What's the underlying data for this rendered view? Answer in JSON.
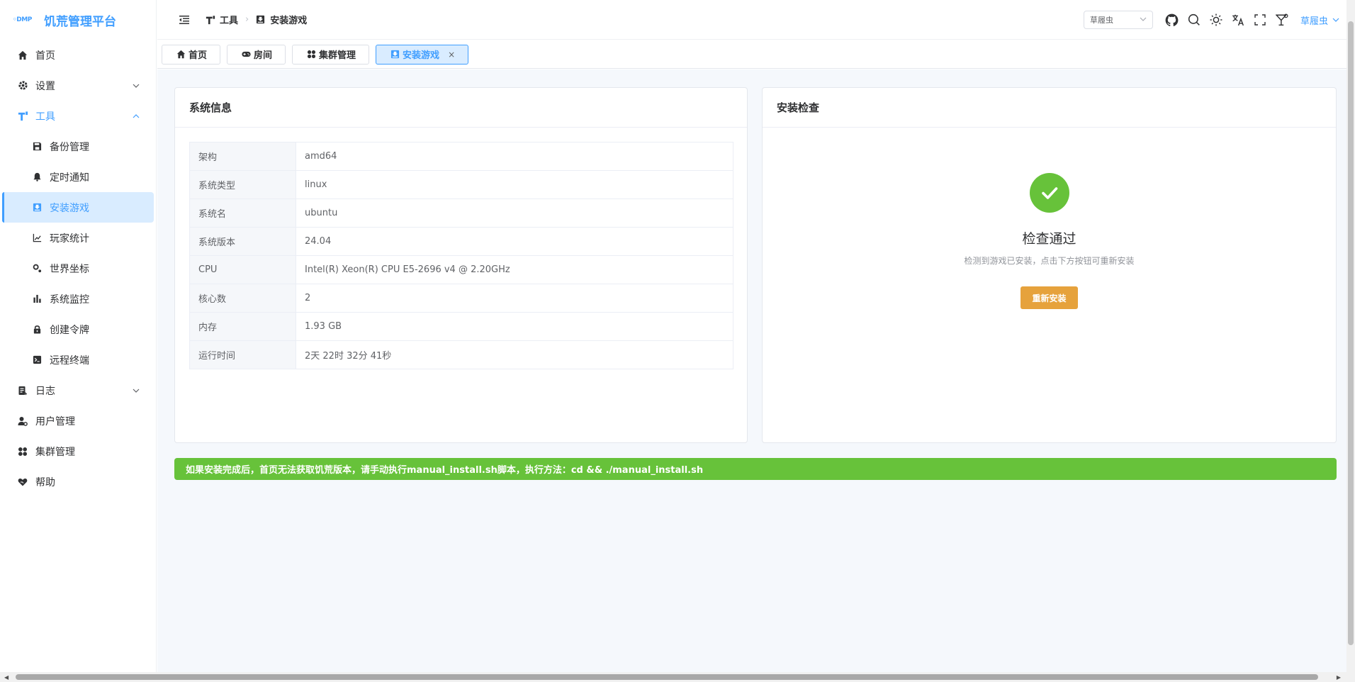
{
  "app": {
    "logo_mark": "DMP",
    "title": "饥荒管理平台"
  },
  "sidebar": {
    "items": [
      {
        "label": "首页"
      },
      {
        "label": "设置"
      },
      {
        "label": "工具"
      },
      {
        "label": "日志"
      },
      {
        "label": "用户管理"
      },
      {
        "label": "集群管理"
      },
      {
        "label": "帮助"
      }
    ],
    "tools_submenu": [
      {
        "label": "备份管理"
      },
      {
        "label": "定时通知"
      },
      {
        "label": "安装游戏"
      },
      {
        "label": "玩家统计"
      },
      {
        "label": "世界坐标"
      },
      {
        "label": "系统监控"
      },
      {
        "label": "创建令牌"
      },
      {
        "label": "远程终端"
      }
    ]
  },
  "header": {
    "breadcrumb": [
      {
        "label": "工具"
      },
      {
        "label": "安装游戏"
      }
    ],
    "cluster_select": "草履虫",
    "user": "草履虫"
  },
  "tabs": [
    {
      "label": "首页"
    },
    {
      "label": "房间"
    },
    {
      "label": "集群管理"
    },
    {
      "label": "安装游戏",
      "close": "×"
    }
  ],
  "system_info": {
    "title": "系统信息",
    "rows": [
      {
        "key": "架构",
        "value": "amd64"
      },
      {
        "key": "系统类型",
        "value": "linux"
      },
      {
        "key": "系统名",
        "value": "ubuntu"
      },
      {
        "key": "系统版本",
        "value": "24.04"
      },
      {
        "key": "CPU",
        "value": "Intel(R) Xeon(R) CPU E5-2696 v4 @ 2.20GHz"
      },
      {
        "key": "核心数",
        "value": "2"
      },
      {
        "key": "内存",
        "value": "1.93 GB"
      },
      {
        "key": "运行时间",
        "value": "2天 22时 32分 41秒"
      }
    ]
  },
  "install_check": {
    "title": "安装检查",
    "result_title": "检查通过",
    "result_desc": "检测到游戏已安装，点击下方按钮可重新安装",
    "button": "重新安装"
  },
  "notice": "如果安装完成后，首页无法获取饥荒版本，请手动执行manual_install.sh脚本，执行方法：cd && ./manual_install.sh",
  "colors": {
    "primary": "#409eff",
    "success": "#67c23a",
    "warning": "#e6a23c"
  }
}
